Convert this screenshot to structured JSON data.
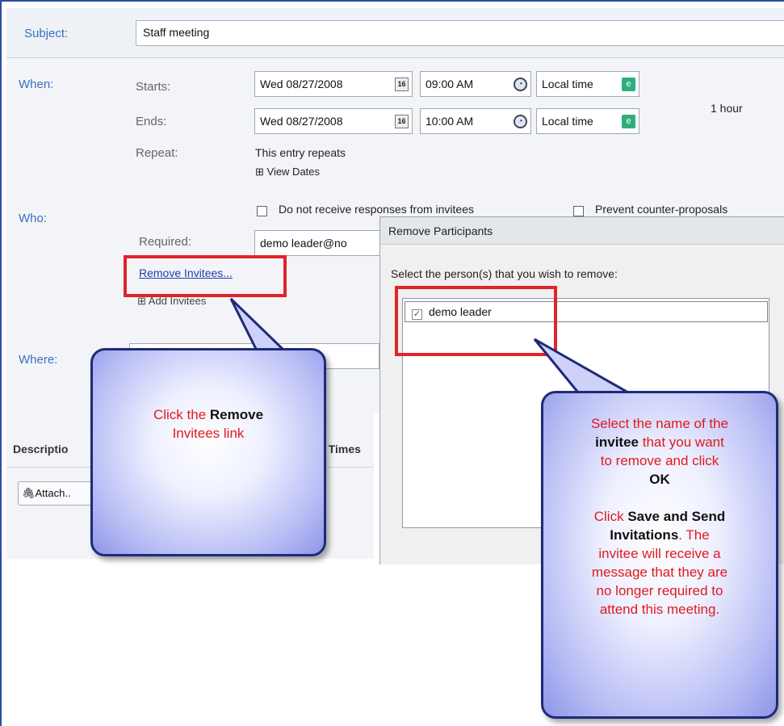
{
  "subject": {
    "label": "Subject:",
    "value": "Staff meeting"
  },
  "when": {
    "label": "When:",
    "starts_label": "Starts:",
    "ends_label": "Ends:",
    "repeat_label": "Repeat:",
    "start_date": "Wed 08/27/2008",
    "start_time": "09:00 AM",
    "start_zone": "Local time",
    "end_date": "Wed 08/27/2008",
    "end_time": "10:00 AM",
    "end_zone": "Local time",
    "calendar_glyph": "16",
    "duration": "1 hour",
    "repeat_text": "This entry repeats",
    "view_dates": "⊞ View Dates"
  },
  "who": {
    "label": "Who:",
    "no_responses_label": "Do not receive responses from invitees",
    "prevent_counter_label": "Prevent counter-proposals",
    "required_label": "Required:",
    "required_value": "demo leader@no",
    "remove_invitees": "Remove Invitees...",
    "add_invitees": "⊞ Add Invitees"
  },
  "where": {
    "label": "Where:"
  },
  "lower": {
    "description_tab": "Descriptio",
    "times_tab": "e Times",
    "attach_button": "Attach.."
  },
  "dialog": {
    "title": "Remove Participants",
    "instruction": "Select the person(s) that you wish to remove:",
    "participants": [
      {
        "name": "demo leader",
        "checked": true
      }
    ]
  },
  "callout_left": {
    "line1_pre": "Click the ",
    "line1_bold": "Remove",
    "line2": "Invitees link"
  },
  "callout_right": {
    "p1_a": "Select the name of the",
    "p1_b_bold": "invitee",
    "p1_c": " that you want",
    "p1_d": "to remove and click",
    "p1_ok": "OK",
    "p2_a": "Click ",
    "p2_b_bold": "Save and Send",
    "p2_c_bold": "Invitations",
    "p2_d": ". The",
    "p2_e": "invitee will receive a",
    "p2_f": "message that they are",
    "p2_g": "no longer required to",
    "p2_h": "attend this meeting."
  },
  "colors": {
    "highlight_red": "#e0242a",
    "callout_text_red": "#e1191e",
    "label_blue": "#3a6fc4",
    "link_blue": "#1f3fae"
  }
}
